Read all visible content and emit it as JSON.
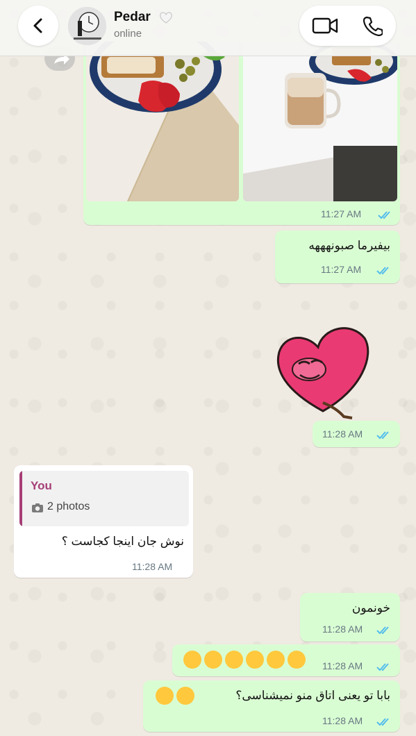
{
  "header": {
    "contact_name": "Pedar",
    "status": "online"
  },
  "messages": {
    "photos_time": "11:27 AM",
    "text1": "بیفیرما صبونهههه",
    "text1_time": "11:27 AM",
    "sticker_time": "11:28 AM",
    "reply": {
      "author": "You",
      "quoted": "2 photos",
      "text": "نوش جان اینجا کجاست ؟",
      "time": "11:28 AM"
    },
    "text2": "خونمون",
    "text2_time": "11:28 AM",
    "emoji_time": "11:28 AM",
    "text3": "بابا تو یعنی اتاق منو نمیشناسی؟",
    "text3_time": "11:28 AM"
  },
  "colors": {
    "outgoing_bubble": "#d9fdd3",
    "incoming_bubble": "#ffffff",
    "read_ticks": "#53bdeb",
    "reply_accent": "#a63e76",
    "wallpaper": "#efeae2"
  },
  "icons": {
    "back": "chevron-left-icon",
    "video": "video-call-icon",
    "phone": "phone-icon",
    "forward": "forward-icon",
    "camera": "camera-icon",
    "ticks": "double-check-icon"
  }
}
